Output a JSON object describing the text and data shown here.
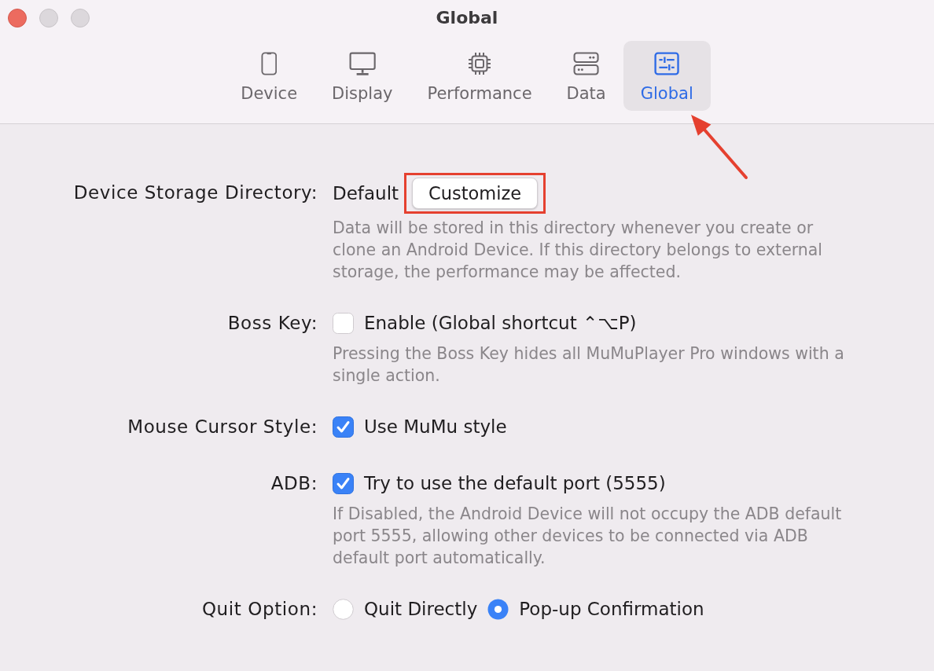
{
  "window": {
    "title": "Global",
    "controls": [
      {
        "kind": "close",
        "disabled": false
      },
      {
        "kind": "minimize",
        "disabled": true
      },
      {
        "kind": "zoom",
        "disabled": true
      }
    ]
  },
  "tabs": [
    {
      "label": "Device",
      "selected": false,
      "callout_arrow": false
    },
    {
      "label": "Display",
      "selected": false,
      "callout_arrow": false
    },
    {
      "label": "Performance",
      "selected": false,
      "callout_arrow": false
    },
    {
      "label": "Data",
      "selected": false,
      "callout_arrow": false
    },
    {
      "label": "Global",
      "selected": true,
      "callout_arrow": true
    }
  ],
  "settings": [
    {
      "kind": "path",
      "label": "Device Storage Directory:",
      "value": "Default",
      "button": {
        "label": "Customize",
        "highlighted": true
      },
      "description": "Data will be stored in this directory whenever you create or clone an Android Device. If this directory belongs to external storage, the performance may be affected."
    },
    {
      "kind": "checkbox",
      "label": "Boss Key:",
      "option": {
        "label": "Enable (Global shortcut ⌃⌥P)",
        "checked": false
      },
      "description": "Pressing the Boss Key hides all MuMuPlayer Pro windows with a single action."
    },
    {
      "kind": "checkbox",
      "label": "Mouse Cursor Style:",
      "option": {
        "label": "Use MuMu style",
        "checked": true
      }
    },
    {
      "kind": "checkbox",
      "label": "ADB:",
      "option": {
        "label": "Try to use the default port (5555)",
        "checked": true
      },
      "description": "If Disabled, the Android Device will not occupy the ADB default port 5555, allowing other devices to be connected via ADB default port automatically."
    },
    {
      "kind": "radio",
      "label": "Quit Option:",
      "options": [
        {
          "label": "Quit Directly",
          "selected": false
        },
        {
          "label": "Pop-up Confirmation",
          "selected": true
        }
      ]
    }
  ]
}
